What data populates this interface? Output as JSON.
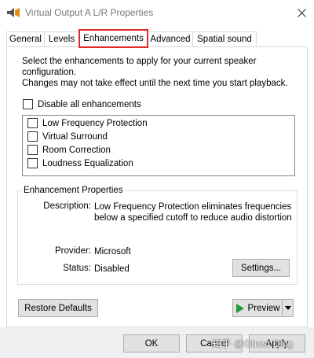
{
  "window": {
    "title": "Virtual Output A L/R Properties",
    "close_glyph": "✕"
  },
  "tabs": [
    {
      "label": "General"
    },
    {
      "label": "Levels"
    },
    {
      "label": "Enhancements"
    },
    {
      "label": "Advanced"
    },
    {
      "label": "Spatial sound"
    }
  ],
  "active_tab": "Enhancements",
  "enhancements": {
    "description_line1": "Select the enhancements to apply for your current speaker configuration.",
    "description_line2": "Changes may not take effect until the next time you start playback.",
    "disable_all_label": "Disable all enhancements",
    "disable_all_checked": false,
    "items": [
      {
        "label": "Low Frequency Protection",
        "checked": false
      },
      {
        "label": "Virtual Surround",
        "checked": false
      },
      {
        "label": "Room Correction",
        "checked": false
      },
      {
        "label": "Loudness Equalization",
        "checked": false
      }
    ]
  },
  "properties": {
    "group_label": "Enhancement Properties",
    "description_label": "Description:",
    "description_line1": "Low Frequency Protection eliminates frequencies",
    "description_line2": "below a specified cutoff to reduce audio distortion",
    "provider_label": "Provider:",
    "provider_value": "Microsoft",
    "status_label": "Status:",
    "status_value": "Disabled",
    "settings_button": "Settings..."
  },
  "actions": {
    "restore_defaults": "Restore Defaults",
    "preview": "Preview"
  },
  "footer": {
    "ok": "OK",
    "cancel": "Cancel",
    "apply": "Apply"
  },
  "watermark": "知乎 @Ghost Ding",
  "icons": {
    "app": "speaker-icon",
    "close": "close-icon",
    "play": "play-icon",
    "dropdown": "chevron-down-icon"
  },
  "colors": {
    "active_tab_outline": "#e02a2a",
    "play_green": "#1e9e3a",
    "button_face": "#e1e1e1"
  }
}
